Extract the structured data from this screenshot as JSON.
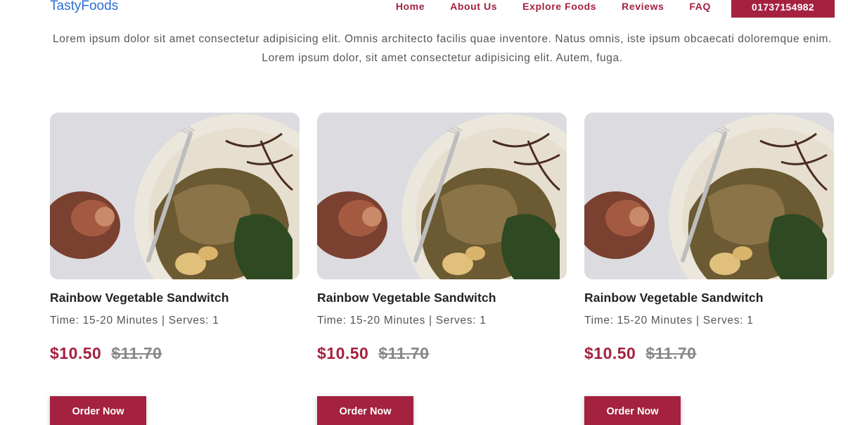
{
  "header": {
    "logo": "TastyFoods",
    "nav": [
      "Home",
      "About Us",
      "Explore Foods",
      "Reviews",
      "FAQ"
    ],
    "phone": "01737154982"
  },
  "intro": {
    "text": "Lorem ipsum dolor sit amet consectetur adipisicing elit. Omnis architecto facilis quae inventore. Natus omnis, iste ipsum obcaecati doloremque enim. Lorem ipsum dolor, sit amet consectetur adipisicing elit. Autem, fuga."
  },
  "cards": [
    {
      "title": "Rainbow Vegetable Sandwitch",
      "meta": "Time: 15-20 Minutes | Serves: 1",
      "price": "$10.50",
      "old_price": "$11.70",
      "button": "Order Now"
    },
    {
      "title": "Rainbow Vegetable Sandwitch",
      "meta": "Time: 15-20 Minutes | Serves: 1",
      "price": "$10.50",
      "old_price": "$11.70",
      "button": "Order Now"
    },
    {
      "title": "Rainbow Vegetable Sandwitch",
      "meta": "Time: 15-20 Minutes | Serves: 1",
      "price": "$10.50",
      "old_price": "$11.70",
      "button": "Order Now"
    }
  ],
  "colors": {
    "accent": "#a4213f",
    "logo": "#2a6fd6"
  }
}
